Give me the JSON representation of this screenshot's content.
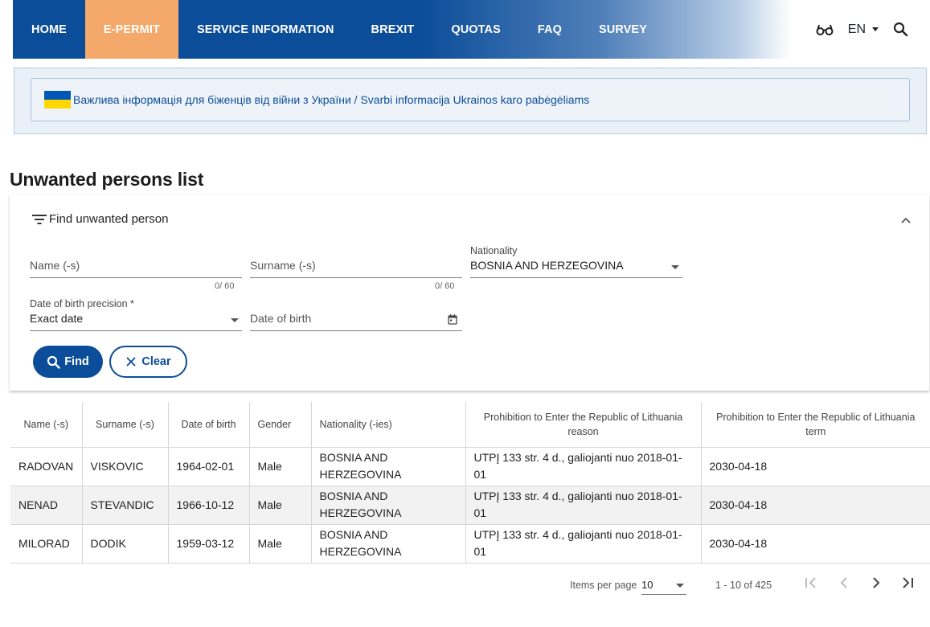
{
  "nav": {
    "items": [
      {
        "label": "HOME",
        "active": false
      },
      {
        "label": "E-PERMIT",
        "active": true
      },
      {
        "label": "SERVICE INFORMATION",
        "active": false
      },
      {
        "label": "BREXIT",
        "active": false
      },
      {
        "label": "QUOTAS",
        "active": false
      },
      {
        "label": "FAQ",
        "active": false
      },
      {
        "label": "SURVEY",
        "active": false
      }
    ],
    "language": "EN",
    "accent_color": "#0c4d99",
    "active_color": "#f4a86a"
  },
  "banner": {
    "text": "Важлива інформація для біженців від війни з України / Svarbi informacija Ukrainos karo pabėgėliams"
  },
  "page": {
    "title": "Unwanted persons list"
  },
  "filter": {
    "header": "Find unwanted person",
    "name_placeholder": "Name (-s)",
    "name_counter": "0/ 60",
    "surname_placeholder": "Surname (-s)",
    "surname_counter": "0/ 60",
    "nationality_label": "Nationality",
    "nationality_value": "BOSNIA AND HERZEGOVINA",
    "dob_precision_label": "Date of birth precision *",
    "dob_precision_value": "Exact date",
    "dob_placeholder": "Date of birth",
    "find_label": "Find",
    "clear_label": "Clear"
  },
  "table": {
    "headers": [
      "Name (-s)",
      "Surname (-s)",
      "Date of birth",
      "Gender",
      "Nationality (-ies)",
      "Prohibition to Enter the Republic of Lithuania reason",
      "Prohibition to Enter the Republic of Lithuania term"
    ],
    "rows": [
      [
        "RADOVAN",
        "VISKOVIC",
        "1964-02-01",
        "Male",
        "BOSNIA AND HERZEGOVINA",
        "UTPĮ 133 str. 4 d., galiojanti nuo 2018-01-01",
        "2030-04-18"
      ],
      [
        "NENAD",
        "STEVANDIC",
        "1966-10-12",
        "Male",
        "BOSNIA AND HERZEGOVINA",
        "UTPĮ 133 str. 4 d., galiojanti nuo 2018-01-01",
        "2030-04-18"
      ],
      [
        "MILORAD",
        "DODIK",
        "1959-03-12",
        "Male",
        "BOSNIA AND HERZEGOVINA",
        "UTPĮ 133 str. 4 d., galiojanti nuo 2018-01-01",
        "2030-04-18"
      ]
    ]
  },
  "paginator": {
    "items_per_page_label": "Items per page",
    "items_per_page": "10",
    "range": "1 - 10 of 425"
  }
}
